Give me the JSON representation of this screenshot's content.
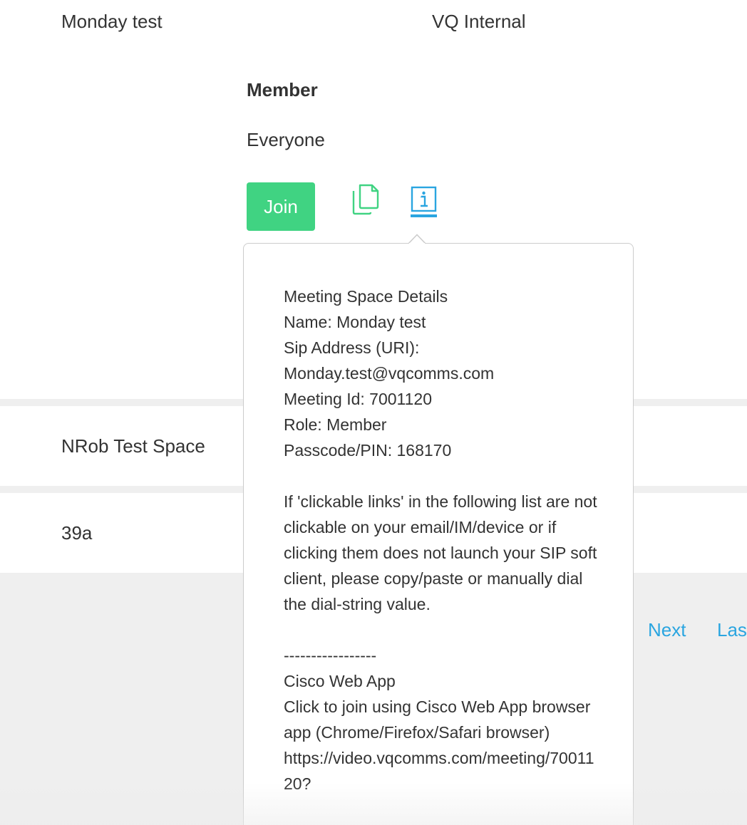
{
  "rows": [
    {
      "name": "Monday test",
      "group": "VQ Internal"
    },
    {
      "name": "NRob Test Space"
    },
    {
      "name": "39a"
    }
  ],
  "details": {
    "role_heading": "Member",
    "role_value": "Everyone",
    "join_label": "Join",
    "copy_icon": "copy-icon",
    "info_icon": "info-icon"
  },
  "popover": {
    "title": "Meeting Space Details",
    "name_line": "Name: Monday test",
    "sip_label": "Sip Address (URI):",
    "sip_value": "Monday.test@vqcomms.com",
    "meeting_id": "Meeting Id: 7001120",
    "role": "Role: Member",
    "passcode": "Passcode/PIN: 168170",
    "instructions": "If 'clickable links' in the following list are not clickable on your email/IM/device or if clicking them does not launch your SIP soft client, please copy/paste or manually dial the dial-string value.",
    "divider": "-----------------",
    "webapp_title": "Cisco Web App",
    "webapp_desc": "Click to join using Cisco Web App browser app (Chrome/Firefox/Safari browser)",
    "webapp_url": "https://video.vqcomms.com/meeting/7001120?"
  },
  "pagination": {
    "next_label": "Next",
    "last_label": "Last"
  },
  "colors": {
    "join_green": "#40d382",
    "icon_green": "#40d382",
    "link_blue": "#2aa5e0",
    "separator_grey": "#efefef"
  }
}
